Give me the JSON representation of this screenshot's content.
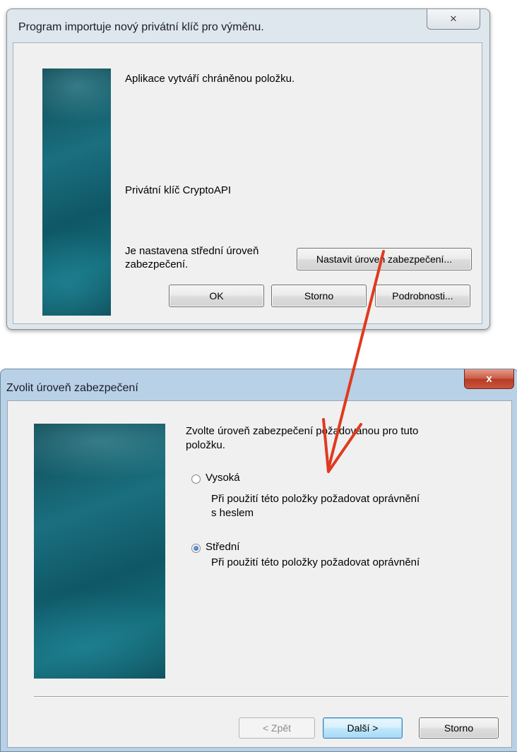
{
  "dialog1": {
    "title": "Program importuje nový privátní klíč pro výměnu.",
    "close_symbol": "✕",
    "message": "Aplikace vytváří chráněnou položku.",
    "item_name": "Privátní klíč CryptoAPI",
    "security_line1": "Je nastavena střední úroveň",
    "security_line2": "zabezpečení.",
    "set_level_button": "Nastavit úroveň zabezpečení...",
    "ok_button": "OK",
    "cancel_button": "Storno",
    "details_button": "Podrobnosti..."
  },
  "dialog2": {
    "title": "Zvolit úroveň zabezpečení",
    "close_symbol": "x",
    "intro_line1": "Zvolte úroveň zabezpečení požadovanou pro tuto",
    "intro_line2": "položku.",
    "options": [
      {
        "label": "Vysoká",
        "desc_line1": "Při použití této položky požadovat oprávnění",
        "desc_line2": "s heslem",
        "checked": false
      },
      {
        "label": "Střední",
        "desc_line1": "Při použití této položky požadovat oprávnění",
        "desc_line2": "",
        "checked": true
      }
    ],
    "back_button": "< Zpět",
    "next_button": "Další >",
    "cancel_button": "Storno"
  },
  "colors": {
    "arrow": "#e03a1e",
    "banner": "#1a6f7f",
    "close_red": "#c9553b"
  }
}
